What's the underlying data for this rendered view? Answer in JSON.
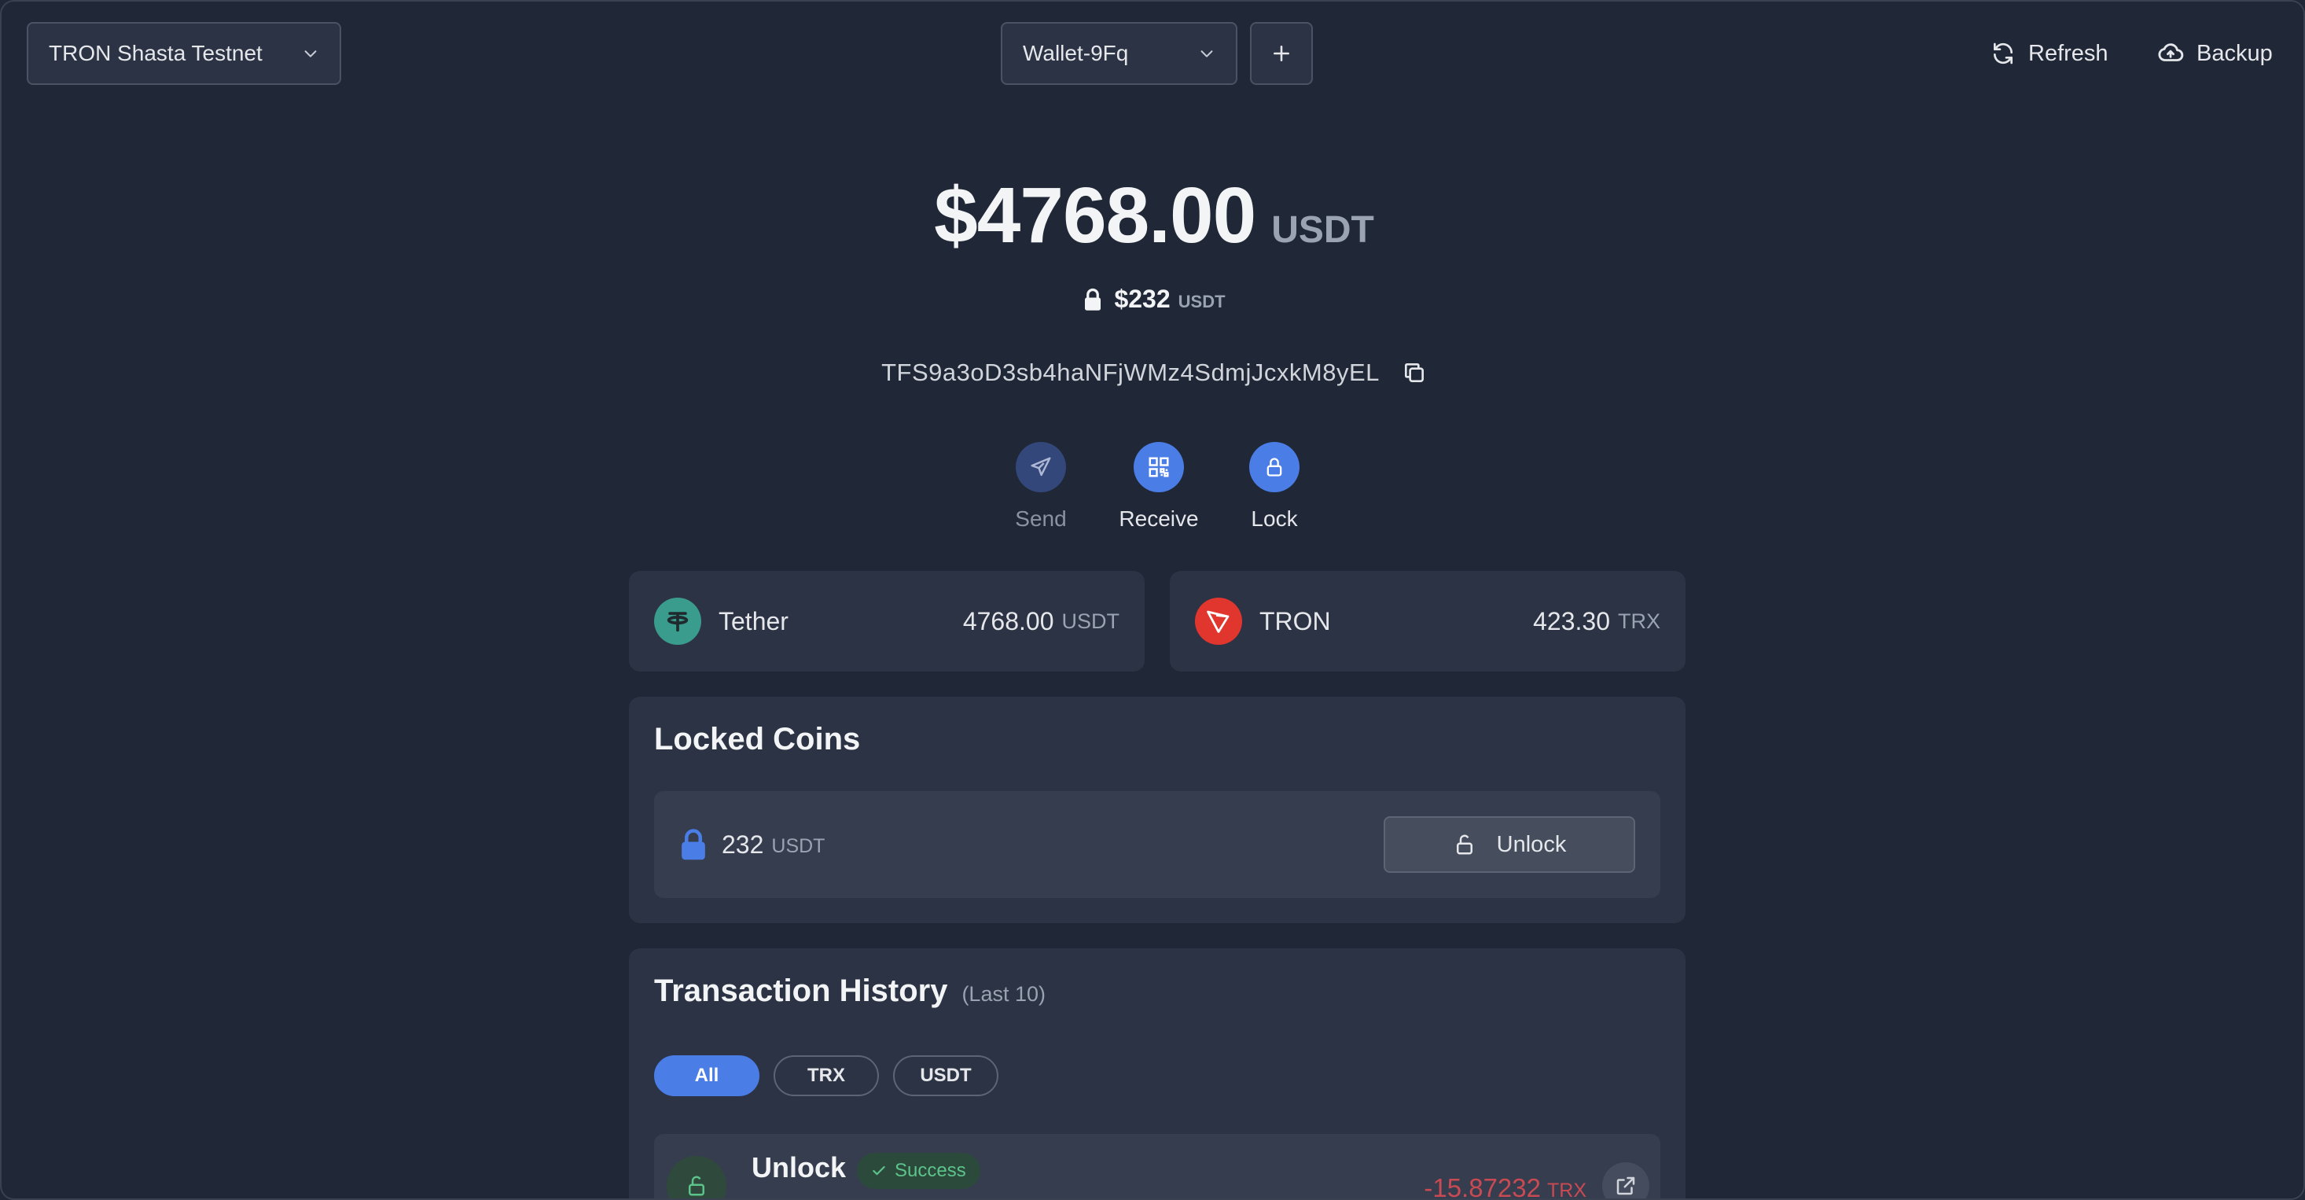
{
  "colors": {
    "background": "#202736",
    "card": "#2b3344",
    "accent": "#4a7de6",
    "success": "#5cc48a",
    "negative": "#c94a52",
    "tether": "#3a9c8c",
    "tron": "#e0362e"
  },
  "header": {
    "network": "TRON Shasta Testnet",
    "wallet": "Wallet-9Fq",
    "add_icon": "plus-icon",
    "refresh_label": "Refresh",
    "backup_label": "Backup"
  },
  "balance": {
    "amount": "$4768.00",
    "unit": "USDT",
    "locked_amount": "$232",
    "locked_unit": "USDT",
    "address": "TFS9a3oD3sb4haNFjWMz4SdmjJcxkM8yEL"
  },
  "actions": [
    {
      "label": "Send",
      "icon": "send-icon",
      "enabled": false
    },
    {
      "label": "Receive",
      "icon": "qr-code-icon",
      "enabled": true
    },
    {
      "label": "Lock",
      "icon": "lock-icon",
      "enabled": true
    }
  ],
  "tokens": [
    {
      "name": "Tether",
      "amount": "4768.00",
      "unit": "USDT",
      "icon": "tether-icon"
    },
    {
      "name": "TRON",
      "amount": "423.30",
      "unit": "TRX",
      "icon": "tron-icon"
    }
  ],
  "locked_coins": {
    "title": "Locked Coins",
    "amount": "232",
    "unit": "USDT",
    "unlock_label": "Unlock"
  },
  "history": {
    "title": "Transaction History",
    "subtitle": "(Last 10)",
    "filters": [
      "All",
      "TRX",
      "USDT"
    ],
    "active_filter": "All",
    "rows": [
      {
        "type": "Unlock",
        "status": "Success",
        "amount": "-15.87232",
        "unit": "TRX"
      }
    ]
  }
}
